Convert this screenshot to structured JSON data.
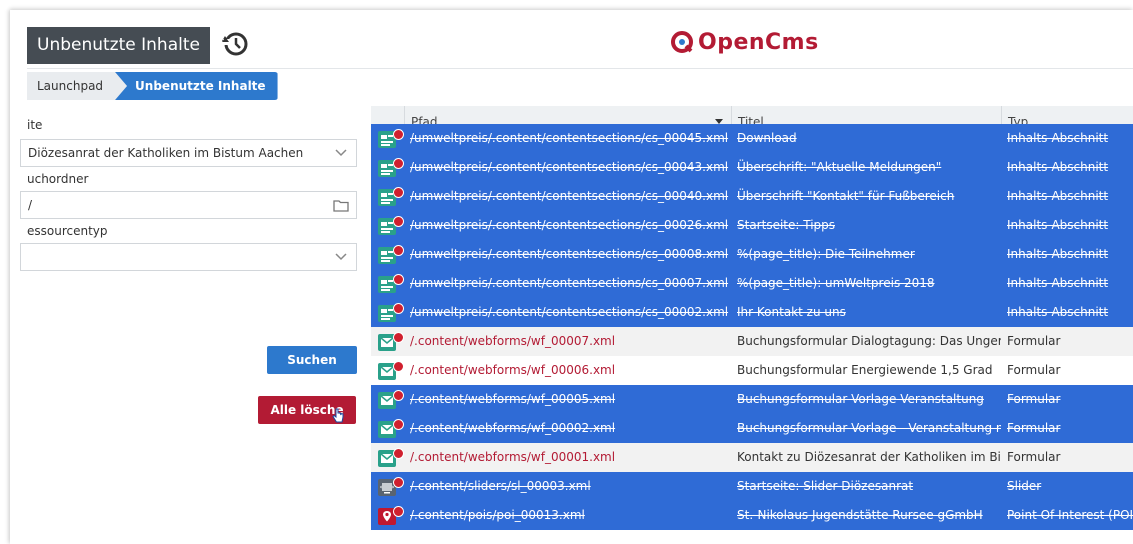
{
  "header": {
    "title": "Unbenutzte Inhalte",
    "logo_text": "OpenCms",
    "colors": {
      "title_bg": "#454c53",
      "brand": "#b31b34",
      "accent": "#2d79cd",
      "selection": "#2f6bd6"
    }
  },
  "breadcrumb": {
    "items": [
      "Launchpad",
      "Unbenutzte Inhalte"
    ]
  },
  "form": {
    "site_label": "ite",
    "site_value": "Diözesanrat der Katholiken im Bistum Aachen",
    "folder_label": "uchordner",
    "folder_value": "/",
    "type_label": "essourcentyp",
    "type_value": "",
    "search_label": "Suchen",
    "delete_label": "Alle lösche"
  },
  "table": {
    "columns": [
      "Pfad",
      "Titel",
      "Typ"
    ],
    "rows": [
      {
        "path": "/umweltpreis/.content/contentsections/cs_00045.xml",
        "title": "Download",
        "type": "Inhalts-Abschnitt",
        "selected": true,
        "icon": "content-section-icon"
      },
      {
        "path": "/umweltpreis/.content/contentsections/cs_00043.xml",
        "title": "Überschrift: \"Aktuelle Meldungen\"",
        "type": "Inhalts-Abschnitt",
        "selected": true,
        "icon": "content-section-icon"
      },
      {
        "path": "/umweltpreis/.content/contentsections/cs_00040.xml",
        "title": "Überschrift \"Kontakt\" für Fußbereich",
        "type": "Inhalts-Abschnitt",
        "selected": true,
        "icon": "content-section-icon"
      },
      {
        "path": "/umweltpreis/.content/contentsections/cs_00026.xml",
        "title": "Startseite: Tipps",
        "type": "Inhalts-Abschnitt",
        "selected": true,
        "icon": "content-section-icon"
      },
      {
        "path": "/umweltpreis/.content/contentsections/cs_00008.xml",
        "title": "%(page_title): Die Teilnehmer",
        "type": "Inhalts-Abschnitt",
        "selected": true,
        "icon": "content-section-icon"
      },
      {
        "path": "/umweltpreis/.content/contentsections/cs_00007.xml",
        "title": "%(page_title): umWeltpreis 2018",
        "type": "Inhalts-Abschnitt",
        "selected": true,
        "icon": "content-section-icon"
      },
      {
        "path": "/umweltpreis/.content/contentsections/cs_00002.xml",
        "title": "Ihr Kontakt zu uns",
        "type": "Inhalts-Abschnitt",
        "selected": true,
        "icon": "content-section-icon"
      },
      {
        "path": "/.content/webforms/wf_00007.xml",
        "title": "Buchungsformular Dialogtagung: Das Ungerec",
        "type": "Formular",
        "selected": false,
        "icon": "webform-icon"
      },
      {
        "path": "/.content/webforms/wf_00006.xml",
        "title": "Buchungsformular Energiewende 1,5 Grad",
        "type": "Formular",
        "selected": false,
        "icon": "webform-icon"
      },
      {
        "path": "/.content/webforms/wf_00005.xml",
        "title": "Buchungsformular Vorlage Veranstaltung",
        "type": "Formular",
        "selected": true,
        "icon": "webform-icon"
      },
      {
        "path": "/.content/webforms/wf_00002.xml",
        "title": "Buchungsformular Vorlage - Veranstaltung mi",
        "type": "Formular",
        "selected": true,
        "icon": "webform-icon"
      },
      {
        "path": "/.content/webforms/wf_00001.xml",
        "title": "Kontakt zu Diözesanrat der Katholiken im Bist",
        "type": "Formular",
        "selected": false,
        "icon": "webform-icon"
      },
      {
        "path": "/.content/sliders/sl_00003.xml",
        "title": "Startseite: Slider Diözesanrat",
        "type": "Slider",
        "selected": true,
        "icon": "slider-icon"
      },
      {
        "path": "/.content/pois/poi_00013.xml",
        "title": "St.-Nikolaus Jugendstätte Rursee gGmbH",
        "type": "Point Of Interest (POI)",
        "selected": true,
        "icon": "poi-icon"
      }
    ]
  }
}
